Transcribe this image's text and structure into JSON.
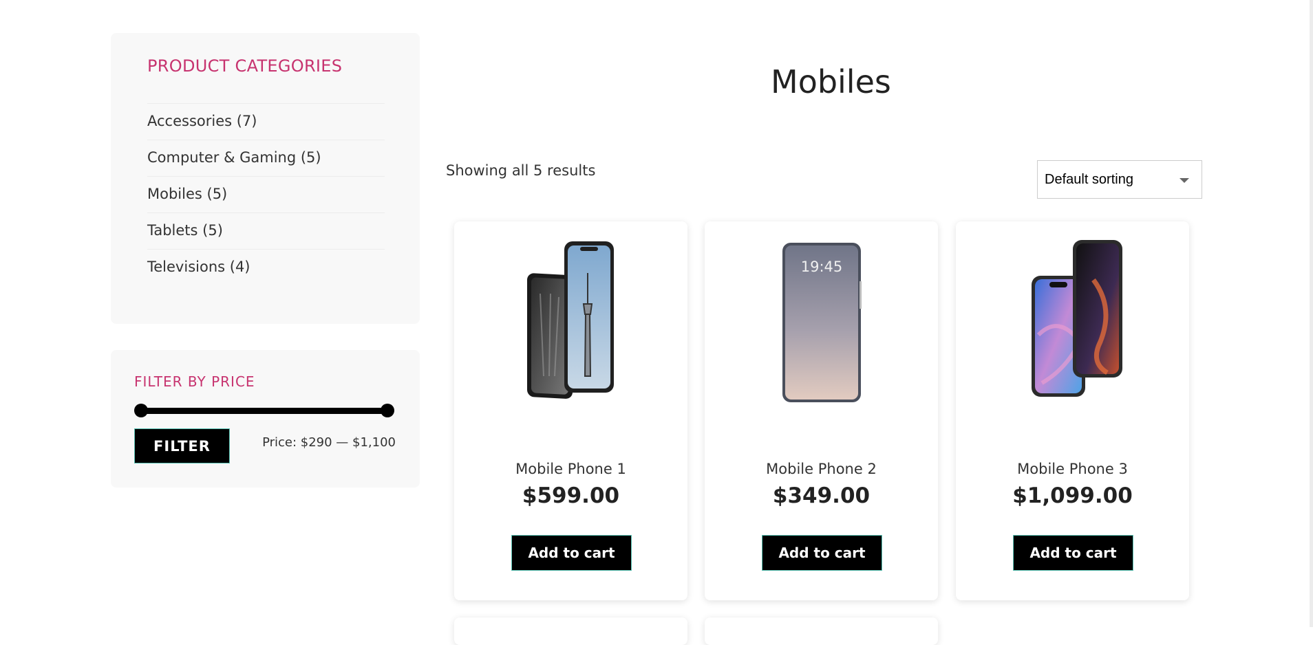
{
  "sidebar": {
    "categories": {
      "title": "PRODUCT CATEGORIES",
      "items": [
        {
          "label": "Accessories (7)"
        },
        {
          "label": "Computer & Gaming (5)"
        },
        {
          "label": "Mobiles (5)"
        },
        {
          "label": "Tablets (5)"
        },
        {
          "label": "Televisions (4)"
        }
      ]
    },
    "price_filter": {
      "title": "FILTER BY PRICE",
      "button_label": "FILTER",
      "price_label": "Price: $290 — $1,100",
      "min_handle_fraction": 0.0,
      "max_handle_fraction": 1.0
    }
  },
  "main": {
    "title": "Mobiles",
    "result_count": "Showing all 5 results",
    "sort": {
      "selected": "Default sorting"
    },
    "products": [
      {
        "name": "Mobile Phone 1",
        "price": "$599.00",
        "button": "Add to cart",
        "image_icon": "dual-phone-image"
      },
      {
        "name": "Mobile Phone 2",
        "price": "$349.00",
        "button": "Add to cart",
        "image_icon": "phone-lockscreen-image",
        "screen_time": "19:45"
      },
      {
        "name": "Mobile Phone 3",
        "price": "$1,099.00",
        "button": "Add to cart",
        "image_icon": "dual-phone-colorful-image"
      }
    ]
  },
  "colors": {
    "accent": "#c7336f",
    "button_bg": "#000000",
    "button_border": "#59c3b4"
  }
}
